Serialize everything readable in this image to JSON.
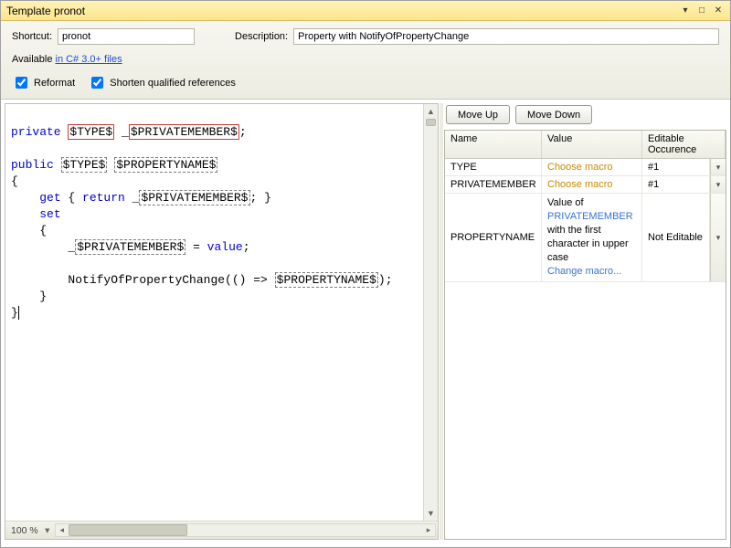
{
  "window": {
    "title": "Template pronot"
  },
  "header": {
    "shortcut_label": "Shortcut:",
    "shortcut_value": "pronot",
    "description_label": "Description:",
    "description_value": "Property with NotifyOfPropertyChange",
    "available_prefix": "Available ",
    "available_link": "in C# 3.0+ files",
    "reformat_label": "Reformat",
    "shorten_label": "Shorten qualified references"
  },
  "editor": {
    "kw_private": "private",
    "kw_public": "public",
    "kw_get": "get",
    "kw_return": "return",
    "kw_set": "set",
    "kw_value": "value",
    "tok_type": "$TYPE$",
    "tok_privatemember": "$PRIVATEMEMBER$",
    "tok_propertyname": "$PROPERTYNAME$",
    "notify_call": "NotifyOfPropertyChange(() => ",
    "underscore": "_",
    "zoom": "100 %"
  },
  "right": {
    "move_up": "Move Up",
    "move_down": "Move Down",
    "hdr_name": "Name",
    "hdr_value": "Value",
    "hdr_occ": "Editable Occurence",
    "rows": [
      {
        "name": "TYPE",
        "value": "Choose macro",
        "occ": "#1"
      },
      {
        "name": "PRIVATEMEMBER",
        "value": "Choose macro",
        "occ": "#1"
      },
      {
        "name": "PROPERTYNAME",
        "value_pre": "Value of ",
        "value_link": "PRIVATEMEMBER",
        "value_post": " with the first character in upper case",
        "value_change": "Change macro...",
        "occ": "Not Editable"
      }
    ]
  }
}
